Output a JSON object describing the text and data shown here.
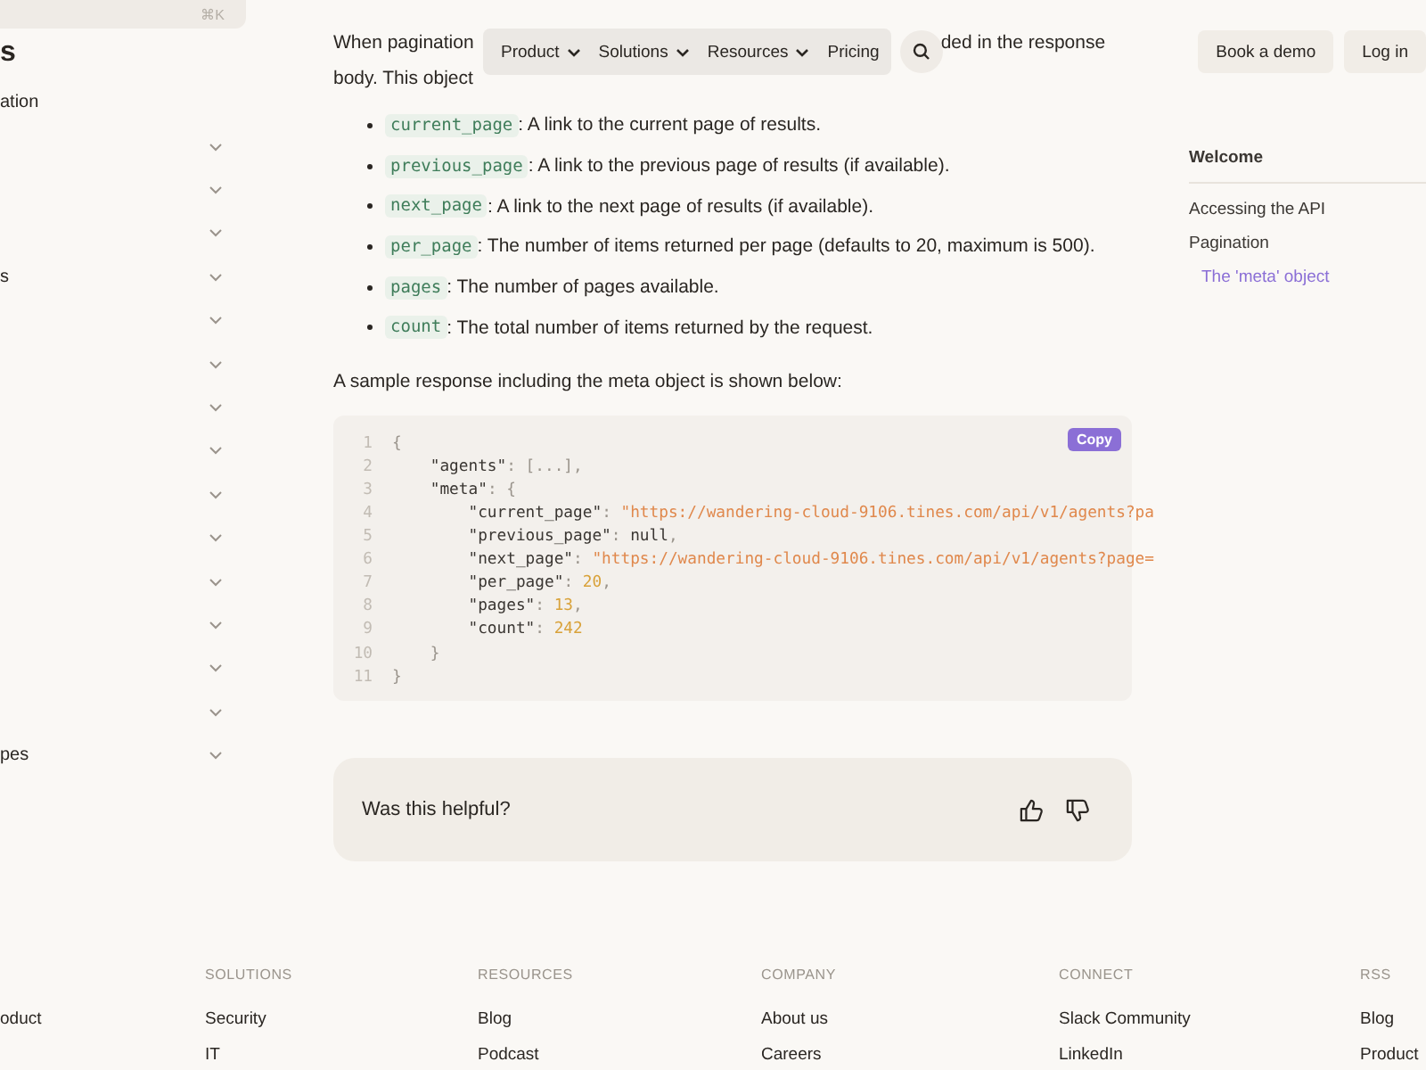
{
  "sidebar": {
    "search": {
      "shortcut": "⌘K"
    },
    "heading": "s",
    "current": "ation",
    "items": [
      {
        "expandable": true
      },
      {
        "expandable": true
      },
      {
        "expandable": true
      },
      {
        "label": "s",
        "expandable": true
      },
      {
        "expandable": true
      },
      {
        "expandable": true
      },
      {
        "expandable": true
      },
      {
        "expandable": true
      },
      {
        "expandable": true
      },
      {
        "expandable": true
      },
      {
        "expandable": true
      },
      {
        "expandable": true
      },
      {
        "expandable": true
      },
      {
        "expandable": true
      },
      {
        "label": "pes",
        "expandable": true
      }
    ]
  },
  "nav": {
    "items": [
      {
        "label": "Product",
        "dropdown": true
      },
      {
        "label": "Solutions",
        "dropdown": true
      },
      {
        "label": "Resources",
        "dropdown": true
      },
      {
        "label": "Pricing",
        "dropdown": false
      }
    ],
    "actions": [
      "Book a demo",
      "Log in"
    ]
  },
  "article": {
    "intro": {
      "start": "When pagination",
      "end": "ded in the response",
      "line2": "body. This object"
    },
    "fields": [
      {
        "code": "current_page",
        "text": ": A link to the current page of results."
      },
      {
        "code": "previous_page",
        "text": ": A link to the previous page of results (if available)."
      },
      {
        "code": "next_page",
        "text": ": A link to the next page of results (if available)."
      },
      {
        "code": "per_page",
        "text": ": The number of items returned per page (defaults to 20, maximum is 500)."
      },
      {
        "code": "pages",
        "text": ": The number of pages available."
      },
      {
        "code": "count",
        "text": ": The total number of items returned by the request."
      }
    ],
    "sample_caption": "A sample response including the meta object is shown below:",
    "code_block": {
      "copy": "Copy",
      "lines": [
        {
          "number": "1",
          "tokens": [
            {
              "kind": "punct",
              "text": "{"
            }
          ]
        },
        {
          "number": "2",
          "tokens": [
            {
              "kind": "key",
              "text": "    \"agents\""
            },
            {
              "kind": "punct",
              "text": ": [...],"
            }
          ]
        },
        {
          "number": "3",
          "tokens": [
            {
              "kind": "key",
              "text": "    \"meta\""
            },
            {
              "kind": "punct",
              "text": ": {"
            }
          ]
        },
        {
          "number": "4",
          "tokens": [
            {
              "kind": "key",
              "text": "        \"current_page\""
            },
            {
              "kind": "punct",
              "text": ": "
            },
            {
              "kind": "string",
              "text": "\"https://wandering-cloud-9106.tines.com/api/v1/agents?pa"
            }
          ]
        },
        {
          "number": "5",
          "tokens": [
            {
              "kind": "key",
              "text": "        \"previous_page\""
            },
            {
              "kind": "punct",
              "text": ": "
            },
            {
              "kind": "null",
              "text": "null"
            },
            {
              "kind": "punct",
              "text": ","
            }
          ]
        },
        {
          "number": "6",
          "tokens": [
            {
              "kind": "key",
              "text": "        \"next_page\""
            },
            {
              "kind": "punct",
              "text": ": "
            },
            {
              "kind": "string",
              "text": "\"https://wandering-cloud-9106.tines.com/api/v1/agents?page="
            }
          ]
        },
        {
          "number": "7",
          "tokens": [
            {
              "kind": "key",
              "text": "        \"per_page\""
            },
            {
              "kind": "punct",
              "text": ": "
            },
            {
              "kind": "number",
              "text": "20"
            },
            {
              "kind": "punct",
              "text": ","
            }
          ]
        },
        {
          "number": "8",
          "tokens": [
            {
              "kind": "key",
              "text": "        \"pages\""
            },
            {
              "kind": "punct",
              "text": ": "
            },
            {
              "kind": "number",
              "text": "13"
            },
            {
              "kind": "punct",
              "text": ","
            }
          ]
        },
        {
          "number": "9",
          "tokens": [
            {
              "kind": "key",
              "text": "        \"count\""
            },
            {
              "kind": "punct",
              "text": ": "
            },
            {
              "kind": "number",
              "text": "242"
            }
          ]
        },
        {
          "number": "10",
          "tokens": [
            {
              "kind": "punct",
              "text": "    }"
            }
          ]
        },
        {
          "number": "11",
          "tokens": [
            {
              "kind": "punct",
              "text": "}"
            }
          ]
        }
      ]
    },
    "feedback": {
      "question": "Was this helpful?"
    }
  },
  "toc": {
    "items": [
      {
        "label": "Welcome",
        "kind": "title",
        "selected": false
      },
      {
        "label": "Accessing the API",
        "kind": "link",
        "selected": false
      },
      {
        "label": "Pagination",
        "kind": "link",
        "selected": false
      },
      {
        "label": "The 'meta' object",
        "kind": "sublink",
        "selected": true
      }
    ]
  },
  "footer": {
    "columns": [
      {
        "links": [
          "oduct"
        ]
      },
      {
        "heading": "SOLUTIONS",
        "links": [
          "Security",
          "IT"
        ]
      },
      {
        "heading": "RESOURCES",
        "links": [
          "Blog",
          "Podcast"
        ]
      },
      {
        "heading": "COMPANY",
        "links": [
          "About us",
          "Careers"
        ]
      },
      {
        "heading": "CONNECT",
        "links": [
          "Slack Community",
          "LinkedIn"
        ]
      },
      {
        "heading": "RSS",
        "links": [
          "Blog",
          "Product"
        ]
      }
    ]
  }
}
